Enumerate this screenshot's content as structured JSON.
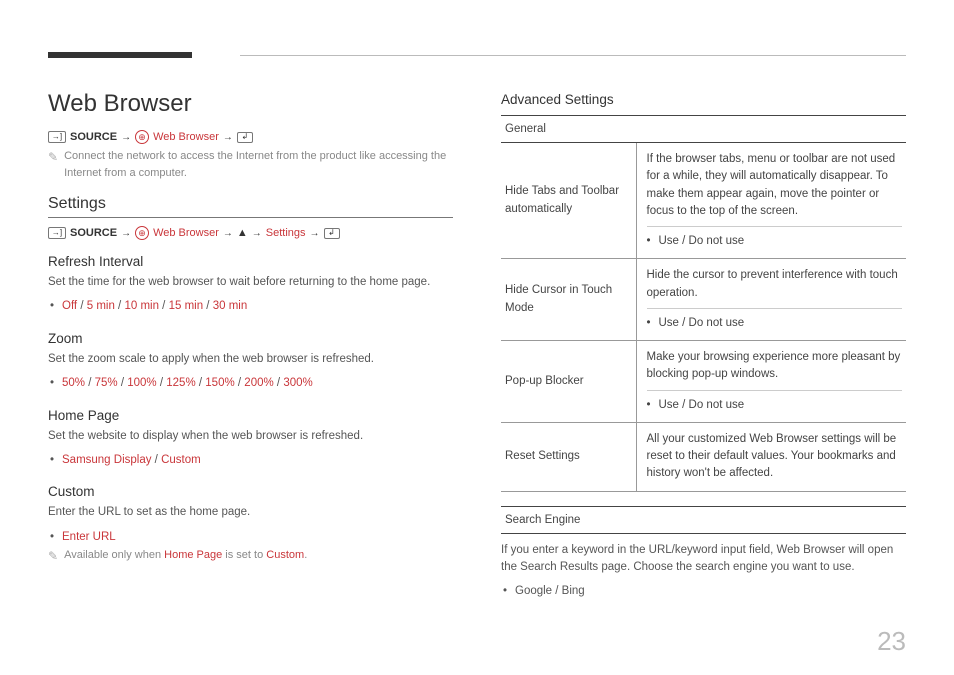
{
  "page": {
    "number": "23",
    "title": "Web Browser"
  },
  "nav": {
    "source_label": "SOURCE",
    "arrow": "→",
    "web_browser": "Web Browser",
    "settings": "Settings",
    "up_caret": "▲"
  },
  "intro_note": "Connect the network to access the Internet from the product like accessing the Internet from a computer.",
  "settings_heading": "Settings",
  "refresh": {
    "heading": "Refresh Interval",
    "desc": "Set the time for the web browser to wait before returning to the home page.",
    "options": [
      "Off",
      "5 min",
      "10 min",
      "15 min",
      "30 min"
    ]
  },
  "zoom": {
    "heading": "Zoom",
    "desc": "Set the zoom scale to apply when the web browser is refreshed.",
    "options": [
      "50%",
      "75%",
      "100%",
      "125%",
      "150%",
      "200%",
      "300%"
    ]
  },
  "home": {
    "heading": "Home Page",
    "desc": "Set the website to display when the web browser is refreshed.",
    "options": [
      "Samsung Display",
      "Custom"
    ]
  },
  "custom": {
    "heading": "Custom",
    "desc": "Enter the URL to set as the home page.",
    "option": "Enter URL",
    "note_prefix": "Available only when ",
    "note_hp": "Home Page",
    "note_mid": " is set to ",
    "note_custom": "Custom",
    "note_suffix": "."
  },
  "advanced": {
    "heading": "Advanced Settings",
    "general_header": "General",
    "rows": [
      {
        "label": "Hide Tabs and Toolbar automatically",
        "desc": "If the browser tabs, menu or toolbar are not used for a while, they will automatically disappear. To make them appear again, move the pointer or focus to the top of the screen.",
        "opts": "Use / Do not use"
      },
      {
        "label": "Hide Cursor in Touch Mode",
        "desc": "Hide the cursor to prevent interference with touch operation.",
        "opts": "Use / Do not use"
      },
      {
        "label": "Pop-up Blocker",
        "desc": "Make your browsing experience more pleasant by blocking pop-up windows.",
        "opts": "Use / Do not use"
      },
      {
        "label": "Reset Settings",
        "desc": "All your customized Web Browser settings will be reset to their default values. Your bookmarks and history won't be affected.",
        "opts": null
      }
    ],
    "search_engine_header": "Search Engine",
    "search_engine_desc": "If you enter a keyword in the URL/keyword input field, Web Browser will open the Search Results page. Choose the search engine you want to use.",
    "search_engine_opts": "Google / Bing"
  }
}
